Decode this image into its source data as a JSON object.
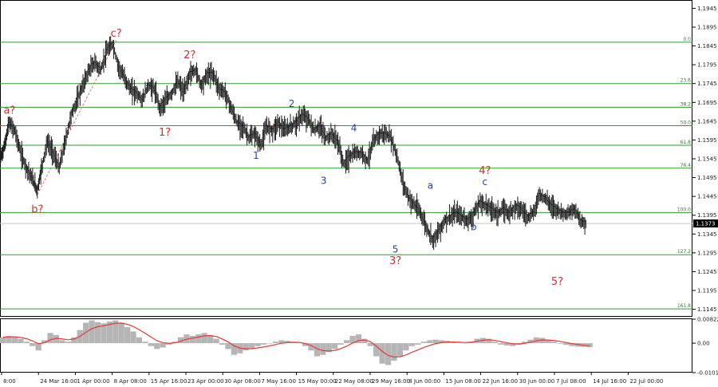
{
  "chart_data": {
    "type": "candlestick",
    "instrument_price": {
      "ylim": [
        1.1125,
        1.1965
      ],
      "y_ticks": [
        "1.1945",
        "1.1895",
        "1.1845",
        "1.1795",
        "1.1745",
        "1.1695",
        "1.1645",
        "1.1595",
        "1.1545",
        "1.1495",
        "1.1445",
        "1.1395",
        "1.1345",
        "1.1295",
        "1.1245",
        "1.1195",
        "1.1145"
      ],
      "current_price": "1.1373",
      "x_ticks": [
        "8:00",
        "24 Mar 16:00",
        "1 Apr 00:00",
        "8 Apr 08:00",
        "15 Apr 16:00",
        "23 Apr 00:00",
        "30 Apr 08:00",
        "7 May 16:00",
        "15 May 00:00",
        "22 May 08:00",
        "29 May 16:00",
        "8 Jun 00:00",
        "15 Jun 08:00",
        "22 Jun 16:00",
        "30 Jun 00:00",
        "7 Jul 08:00",
        "14 Jul 16:00",
        "22 Jul 00:00"
      ],
      "price_path": [
        [
          0.0,
          1.1545
        ],
        [
          0.008,
          1.158
        ],
        [
          0.015,
          1.164
        ],
        [
          0.025,
          1.162
        ],
        [
          0.035,
          1.156
        ],
        [
          0.045,
          1.152
        ],
        [
          0.055,
          1.149
        ],
        [
          0.063,
          1.146
        ],
        [
          0.07,
          1.152
        ],
        [
          0.08,
          1.159
        ],
        [
          0.09,
          1.156
        ],
        [
          0.1,
          1.152
        ],
        [
          0.11,
          1.159
        ],
        [
          0.12,
          1.166
        ],
        [
          0.13,
          1.17
        ],
        [
          0.14,
          1.174
        ],
        [
          0.15,
          1.178
        ],
        [
          0.16,
          1.18
        ],
        [
          0.17,
          1.178
        ],
        [
          0.18,
          1.183
        ],
        [
          0.19,
          1.185
        ],
        [
          0.2,
          1.179
        ],
        [
          0.21,
          1.176
        ],
        [
          0.22,
          1.173
        ],
        [
          0.23,
          1.172
        ],
        [
          0.24,
          1.17
        ],
        [
          0.25,
          1.174
        ],
        [
          0.26,
          1.173
        ],
        [
          0.27,
          1.168
        ],
        [
          0.28,
          1.17
        ],
        [
          0.29,
          1.172
        ],
        [
          0.3,
          1.175
        ],
        [
          0.31,
          1.172
        ],
        [
          0.32,
          1.177
        ],
        [
          0.33,
          1.178
        ],
        [
          0.34,
          1.174
        ],
        [
          0.35,
          1.177
        ],
        [
          0.36,
          1.177
        ],
        [
          0.37,
          1.173
        ],
        [
          0.38,
          1.172
        ],
        [
          0.39,
          1.168
        ],
        [
          0.4,
          1.164
        ],
        [
          0.41,
          1.163
        ],
        [
          0.42,
          1.16
        ],
        [
          0.43,
          1.161
        ],
        [
          0.44,
          1.158
        ],
        [
          0.45,
          1.163
        ],
        [
          0.46,
          1.162
        ],
        [
          0.47,
          1.164
        ],
        [
          0.48,
          1.162
        ],
        [
          0.49,
          1.163
        ],
        [
          0.5,
          1.164
        ],
        [
          0.51,
          1.166
        ],
        [
          0.52,
          1.165
        ],
        [
          0.53,
          1.162
        ],
        [
          0.54,
          1.163
        ],
        [
          0.55,
          1.16
        ],
        [
          0.56,
          1.161
        ],
        [
          0.57,
          1.159
        ],
        [
          0.58,
          1.153
        ],
        [
          0.59,
          1.155
        ],
        [
          0.6,
          1.156
        ],
        [
          0.61,
          1.156
        ],
        [
          0.62,
          1.154
        ],
        [
          0.63,
          1.159
        ],
        [
          0.64,
          1.161
        ],
        [
          0.65,
          1.161
        ],
        [
          0.66,
          1.16
        ],
        [
          0.67,
          1.155
        ],
        [
          0.68,
          1.148
        ],
        [
          0.69,
          1.144
        ],
        [
          0.7,
          1.142
        ],
        [
          0.71,
          1.14
        ],
        [
          0.72,
          1.136
        ],
        [
          0.73,
          1.133
        ],
        [
          0.74,
          1.135
        ],
        [
          0.75,
          1.138
        ],
        [
          0.76,
          1.139
        ],
        [
          0.77,
          1.14
        ],
        [
          0.78,
          1.139
        ],
        [
          0.79,
          1.138
        ],
        [
          0.8,
          1.14
        ],
        [
          0.81,
          1.143
        ],
        [
          0.82,
          1.142
        ],
        [
          0.83,
          1.141
        ],
        [
          0.84,
          1.14
        ],
        [
          0.85,
          1.141
        ],
        [
          0.86,
          1.14
        ],
        [
          0.87,
          1.142
        ],
        [
          0.88,
          1.141
        ],
        [
          0.89,
          1.139
        ],
        [
          0.9,
          1.14
        ],
        [
          0.91,
          1.145
        ],
        [
          0.92,
          1.144
        ],
        [
          0.93,
          1.142
        ],
        [
          0.94,
          1.141
        ],
        [
          0.95,
          1.14
        ],
        [
          0.96,
          1.14
        ],
        [
          0.97,
          1.141
        ],
        [
          0.98,
          1.138
        ],
        [
          0.99,
          1.1373
        ]
      ],
      "fibonacci_levels": [
        {
          "label": "0.0",
          "price": 1.1855
        },
        {
          "label": "23.6",
          "price": 1.1745
        },
        {
          "label": "38.2",
          "price": 1.1682
        },
        {
          "label": "50.0",
          "price": 1.1633
        },
        {
          "label": "61.8",
          "price": 1.1581
        },
        {
          "label": "76.4",
          "price": 1.152
        },
        {
          "label": "100.0",
          "price": 1.1402
        },
        {
          "label": "127.2",
          "price": 1.129
        },
        {
          "label": "161.8",
          "price": 1.1146
        }
      ],
      "wave_labels": [
        {
          "text": "a?",
          "x": 0.016,
          "price": 1.1665,
          "color": "red"
        },
        {
          "text": "b?",
          "x": 0.063,
          "price": 1.1402,
          "color": "red"
        },
        {
          "text": "c?",
          "x": 0.196,
          "price": 1.187,
          "color": "red"
        },
        {
          "text": "1?",
          "x": 0.278,
          "price": 1.1607,
          "color": "red"
        },
        {
          "text": "2?",
          "x": 0.32,
          "price": 1.1812,
          "color": "red"
        },
        {
          "text": "1",
          "x": 0.432,
          "price": 1.1545,
          "color": "blue"
        },
        {
          "text": "2",
          "x": 0.492,
          "price": 1.1683,
          "color": "blue"
        },
        {
          "text": "3",
          "x": 0.546,
          "price": 1.1478,
          "color": "blue"
        },
        {
          "text": "4",
          "x": 0.597,
          "price": 1.1618,
          "color": "blue"
        },
        {
          "text": "5",
          "x": 0.667,
          "price": 1.1296,
          "color": "blue"
        },
        {
          "text": "3?",
          "x": 0.667,
          "price": 1.1265,
          "color": "red"
        },
        {
          "text": "a",
          "x": 0.726,
          "price": 1.1465,
          "color": "blue"
        },
        {
          "text": "b",
          "x": 0.799,
          "price": 1.1355,
          "color": "blue"
        },
        {
          "text": "c",
          "x": 0.818,
          "price": 1.1475,
          "color": "blue"
        },
        {
          "text": "4?",
          "x": 0.818,
          "price": 1.1505,
          "color": "red"
        },
        {
          "text": "5?",
          "x": 0.94,
          "price": 1.121,
          "color": "red"
        }
      ]
    },
    "oscillator": {
      "type": "histogram",
      "y_ticks": [
        "0.00822",
        "0.00",
        "-0.0101"
      ],
      "ylim": [
        -0.0101,
        0.00822
      ],
      "values": [
        0.002,
        0.0025,
        0.0022,
        0.0015,
        0.0005,
        -0.001,
        -0.0025,
        0.001,
        0.0035,
        0.0028,
        0.001,
        0.0005,
        0.002,
        0.0045,
        0.007,
        0.0078,
        0.0072,
        0.0068,
        0.0074,
        0.0078,
        0.007,
        0.0055,
        0.004,
        0.002,
        0.0005,
        -0.001,
        -0.002,
        -0.0015,
        -0.0005,
        0.0005,
        0.002,
        0.003,
        0.0025,
        0.003,
        0.0035,
        0.0028,
        0.0015,
        -0.0005,
        -0.002,
        -0.004,
        -0.0035,
        -0.0025,
        -0.0018,
        -0.001,
        -0.0005,
        0.0,
        0.0005,
        0.001,
        0.0008,
        0.0005,
        0.0002,
        -0.001,
        -0.0025,
        -0.0045,
        -0.004,
        -0.003,
        -0.002,
        -0.0005,
        0.001,
        0.0025,
        0.003,
        0.0015,
        -0.001,
        -0.0045,
        -0.007,
        -0.0075,
        -0.006,
        -0.0045,
        -0.0025,
        -0.001,
        -0.0005,
        0.0005,
        0.001,
        0.0012,
        0.001,
        0.0008,
        0.0005,
        0.0002,
        0.0,
        0.0005,
        0.0015,
        0.0018,
        0.0015,
        0.0005,
        -0.0005,
        -0.0008,
        -0.001,
        -0.0005,
        0.0005,
        0.0012,
        0.002,
        0.0018,
        0.001,
        0.0005,
        -0.0002,
        -0.0006,
        -0.001,
        -0.0012,
        -0.0013,
        -0.0014
      ]
    }
  }
}
